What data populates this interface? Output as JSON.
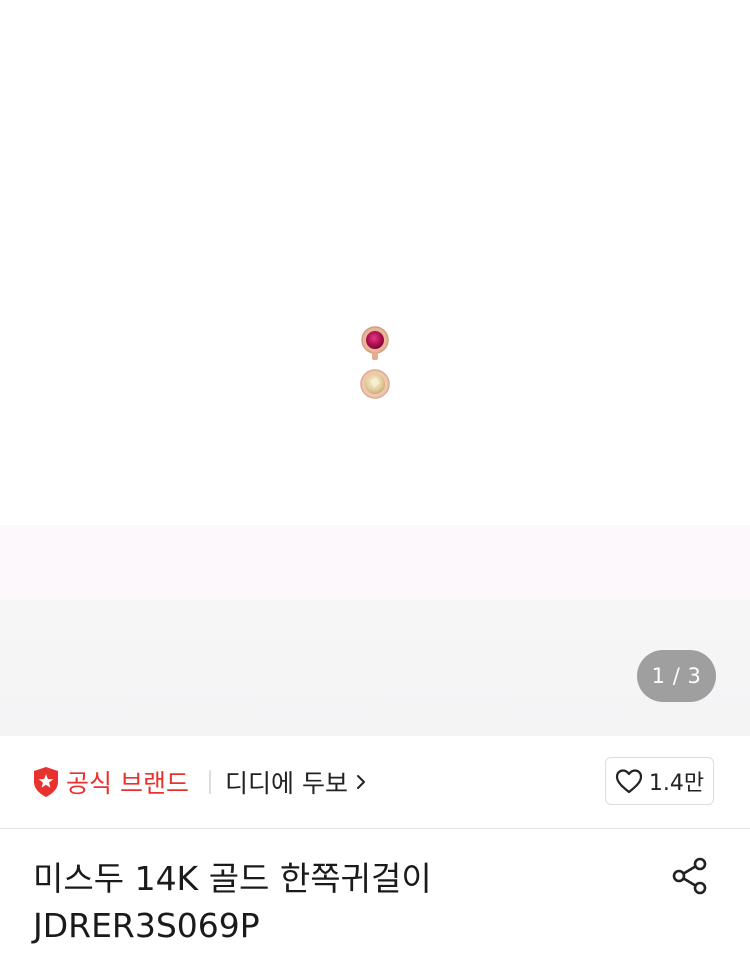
{
  "gallery": {
    "image_alt": "earring",
    "current_page": "1",
    "separator": "/",
    "total_pages": "3",
    "indicator_text": "1 / 3"
  },
  "brand_row": {
    "official_label": "공식 브랜드",
    "brand_name": "디디에 두보",
    "like_count": "1.4만"
  },
  "product": {
    "title_line1": "미스두 14K 골드 한쪽귀걸이",
    "title_line2": "JDRER3S069P"
  },
  "colors": {
    "official_red": "#e8322f",
    "indicator_bg": "#9f9f9f",
    "text_dark": "#222222"
  },
  "icons": {
    "official": "shield-star-icon",
    "brand_chevron": "chevron-right-icon",
    "like": "heart-outline-icon",
    "share": "share-icon"
  }
}
